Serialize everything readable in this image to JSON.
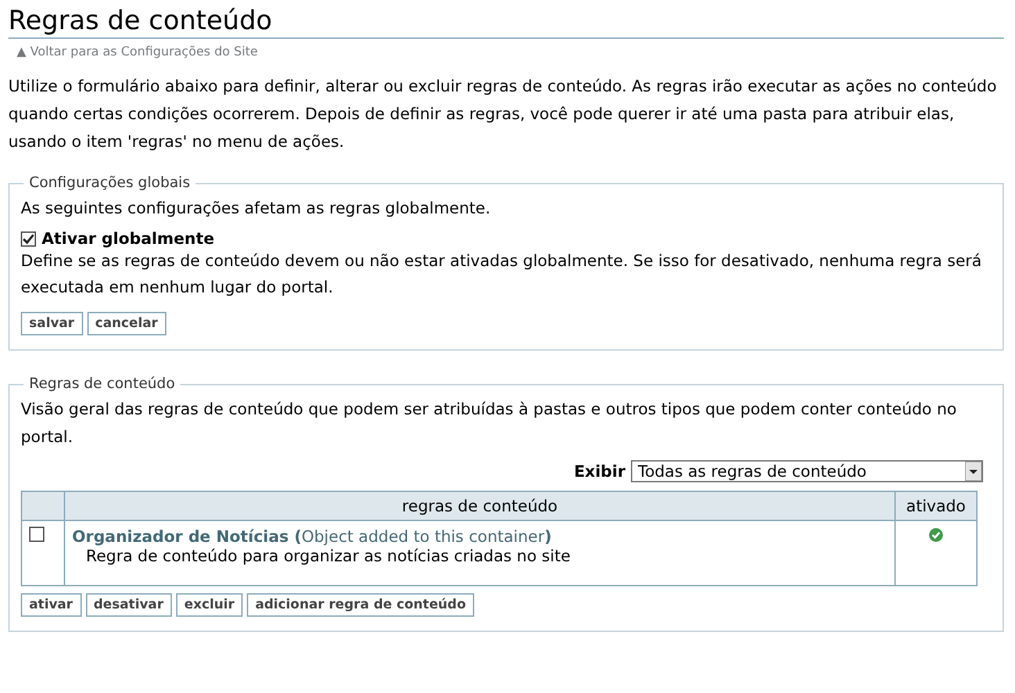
{
  "title": "Regras de conteúdo",
  "back_link": {
    "arrow": "▲",
    "label": "Voltar para as Configurações do Site"
  },
  "intro": "Utilize o formulário abaixo para definir, alterar ou excluir regras de conteúdo. As regras irão executar as ações no conteúdo quando certas condições ocorrerem. Depois de definir as regras, você pode querer ir até uma pasta para atribuir elas, usando o item 'regras' no menu de ações.",
  "global_settings": {
    "legend": "Configurações globais",
    "description": "As seguintes configurações afetam as regras globalmente.",
    "option": {
      "label": "Ativar globalmente",
      "checked": true,
      "help": "Define se as regras de conteúdo devem ou não estar ativadas globalmente. Se isso for desativado, nenhuma regra será executada em nenhum lugar do portal."
    },
    "buttons": [
      "salvar",
      "cancelar"
    ]
  },
  "rules": {
    "legend": "Regras de conteúdo",
    "description": "Visão geral das regras de conteúdo que podem ser atribuídas à pastas e outros tipos que podem conter conteúdo no portal.",
    "filter": {
      "label": "Exibir",
      "value": "Todas as regras de conteúdo"
    },
    "columns": [
      "regras de conteúdo",
      "ativado"
    ],
    "rows": [
      {
        "checked": false,
        "title": "**Organizador de Notícias (**Object added to this container**)**",
        "description": "Regra de conteúdo para organizar as notícias criadas no site",
        "enabled": true
      }
    ],
    "buttons": [
      "ativar",
      "desativar",
      "excluir",
      "adicionar regra de conteúdo"
    ]
  }
}
